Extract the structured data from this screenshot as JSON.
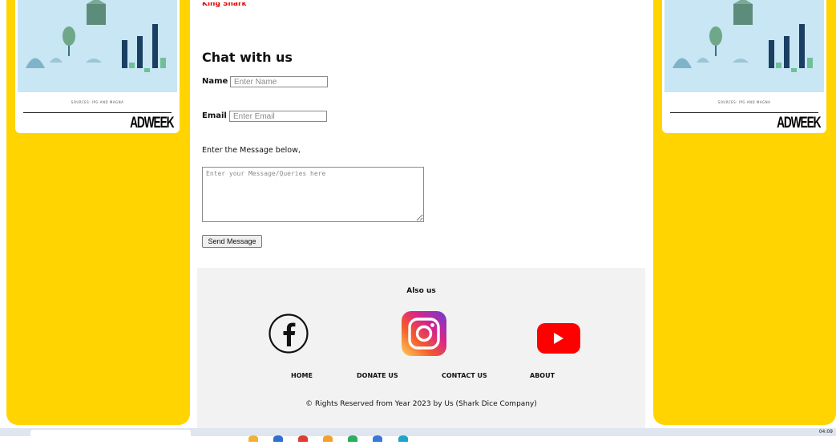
{
  "ad": {
    "sources": "SOURCES: IPG AND MAGNA",
    "logo": "ADWEEK"
  },
  "article": {
    "kicker": "King Shark"
  },
  "chat": {
    "title": "Chat with us",
    "name_label": "Name",
    "name_placeholder": "Enter Name",
    "email_label": "Email",
    "email_placeholder": "Enter Email",
    "message_prompt": "Enter the Message below,",
    "message_placeholder": "Enter your Message/Queries here",
    "send_label": "Send Message"
  },
  "footer": {
    "also_us": "Also us",
    "social": [
      "facebook-icon",
      "instagram-icon",
      "youtube-icon"
    ],
    "nav": [
      "HOME",
      "DONATE US",
      "CONTACT US",
      "ABOUT"
    ],
    "copyright": "© Rights Reserved from Year 2023 by Us (Shark Dice Company)"
  },
  "taskbar": {
    "clock": "04:09"
  },
  "colors": {
    "side_panel": "#ffd400",
    "kicker": "#e00000",
    "footer_bg": "#f2f2f2",
    "youtube": "#ff0000"
  }
}
